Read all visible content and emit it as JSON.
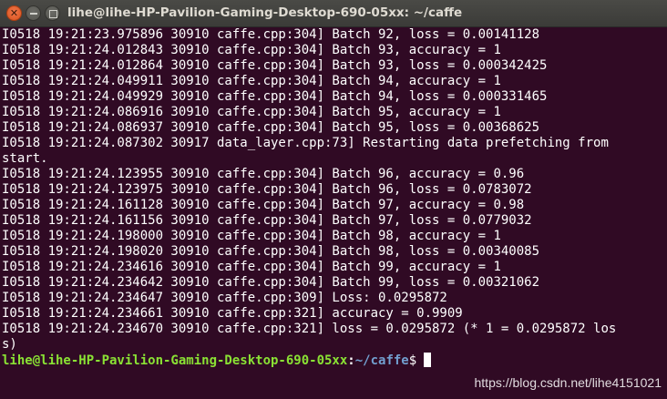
{
  "window": {
    "title": "lihe@lihe-HP-Pavilion-Gaming-Desktop-690-05xx: ~/caffe",
    "close_glyph": "✕",
    "colors": {
      "background": "#300a24",
      "text": "#ffffff",
      "prompt_user": "#8ae234",
      "prompt_path": "#729fcf",
      "close_button": "#e35d28"
    }
  },
  "terminal": {
    "lines": [
      "I0518 19:21:23.975896 30910 caffe.cpp:304] Batch 92, loss = 0.00141128",
      "I0518 19:21:24.012843 30910 caffe.cpp:304] Batch 93, accuracy = 1",
      "I0518 19:21:24.012864 30910 caffe.cpp:304] Batch 93, loss = 0.000342425",
      "I0518 19:21:24.049911 30910 caffe.cpp:304] Batch 94, accuracy = 1",
      "I0518 19:21:24.049929 30910 caffe.cpp:304] Batch 94, loss = 0.000331465",
      "I0518 19:21:24.086916 30910 caffe.cpp:304] Batch 95, accuracy = 1",
      "I0518 19:21:24.086937 30910 caffe.cpp:304] Batch 95, loss = 0.00368625",
      "I0518 19:21:24.087302 30917 data_layer.cpp:73] Restarting data prefetching from",
      "start.",
      "I0518 19:21:24.123955 30910 caffe.cpp:304] Batch 96, accuracy = 0.96",
      "I0518 19:21:24.123975 30910 caffe.cpp:304] Batch 96, loss = 0.0783072",
      "I0518 19:21:24.161128 30910 caffe.cpp:304] Batch 97, accuracy = 0.98",
      "I0518 19:21:24.161156 30910 caffe.cpp:304] Batch 97, loss = 0.0779032",
      "I0518 19:21:24.198000 30910 caffe.cpp:304] Batch 98, accuracy = 1",
      "I0518 19:21:24.198020 30910 caffe.cpp:304] Batch 98, loss = 0.00340085",
      "I0518 19:21:24.234616 30910 caffe.cpp:304] Batch 99, accuracy = 1",
      "I0518 19:21:24.234642 30910 caffe.cpp:304] Batch 99, loss = 0.00321062",
      "I0518 19:21:24.234647 30910 caffe.cpp:309] Loss: 0.0295872",
      "I0518 19:21:24.234661 30910 caffe.cpp:321] accuracy = 0.9909",
      "I0518 19:21:24.234670 30910 caffe.cpp:321] loss = 0.0295872 (* 1 = 0.0295872 los",
      "s)"
    ],
    "prompt": {
      "user_host": "lihe@lihe-HP-Pavilion-Gaming-Desktop-690-05xx",
      "separator": ":",
      "path": "~/caffe",
      "symbol": "$"
    }
  },
  "watermark": {
    "text": "https://blog.csdn.net/lihe4151021"
  }
}
